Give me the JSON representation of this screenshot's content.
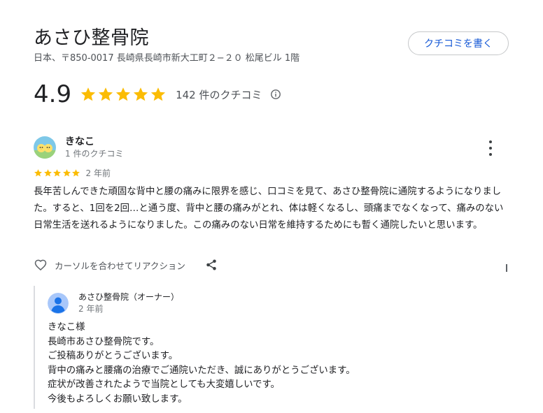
{
  "business": {
    "name": "あさひ整骨院",
    "address": "日本、〒850-0017 長崎県長崎市新大工町２−２０ 松尾ビル 1階",
    "write_review_label": "クチコミを書く"
  },
  "rating": {
    "value": "4.9",
    "stars": 5,
    "review_count_label": "142 件のクチコミ",
    "info_icon": "info-icon"
  },
  "review": {
    "reviewer_name": "きなこ",
    "reviewer_meta": "1 件のクチコミ",
    "stars": 5,
    "date": "2 年前",
    "text": "長年苦しんできた頑固な背中と腰の痛みに限界を感じ、口コミを見て、あさひ整骨院に通院するようになりました。すると、1回を2回…と通う度、背中と腰の痛みがとれ、体は軽くなるし、頭痛までなくなって、痛みのない日常生活を送れるようになりました。この痛みのない日常を維持するためにも暫く通院したいと思います。",
    "reaction_hint": "カーソルを合わせてリアクション"
  },
  "owner_reply": {
    "name": "あさひ整骨院（オーナー）",
    "date": "2 年前",
    "lines": [
      "きなこ様",
      "長崎市あさひ整骨院です。",
      "ご投稿ありがとうございます。",
      "背中の痛みと腰痛の治療でご通院いただき、誠にありがとうございます。",
      "症状が改善されたようで当院としても大変嬉しいです。",
      "今後もよろしくお願い致します。"
    ]
  },
  "colors": {
    "star": "#fbbc04",
    "link": "#1558d6",
    "text": "#202124",
    "muted": "#70757a"
  }
}
